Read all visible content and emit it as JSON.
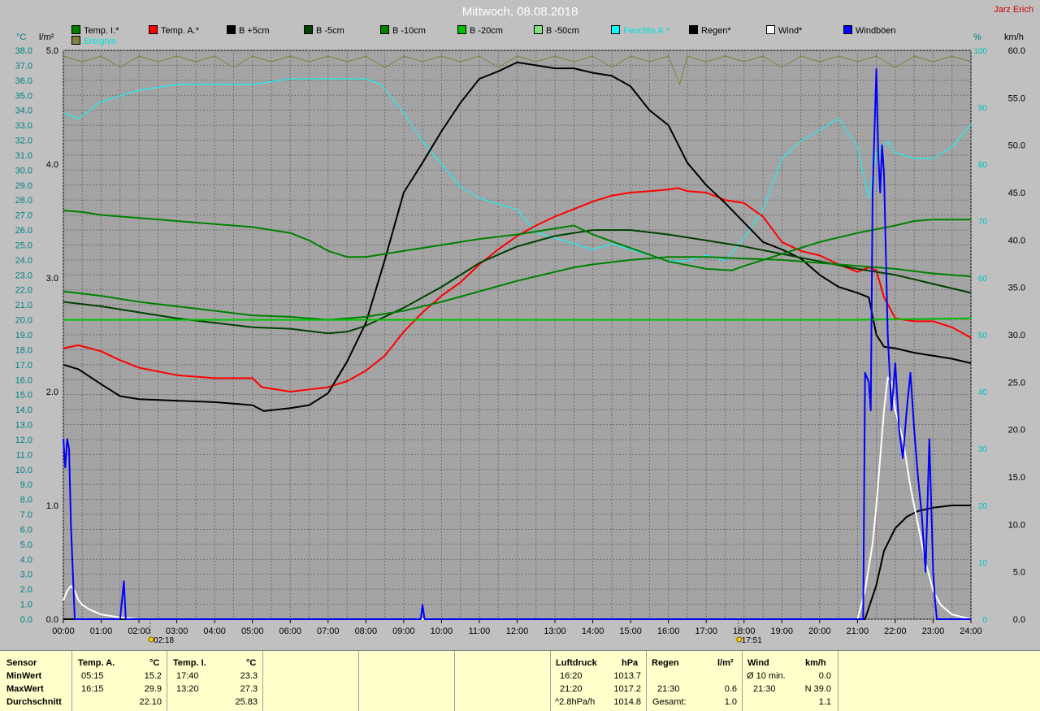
{
  "header": {
    "title": "Mittwoch, 08.08.2018",
    "author": "Jarz Erich"
  },
  "legend": [
    {
      "label": "Temp. I.*",
      "color": "#008000"
    },
    {
      "label": "Temp. A.*",
      "color": "#ff0000"
    },
    {
      "label": "B +5cm",
      "color": "#000000"
    },
    {
      "label": "B -5cm",
      "color": "#004000"
    },
    {
      "label": "B -10cm",
      "color": "#008000"
    },
    {
      "label": "B -20cm",
      "color": "#00c000"
    },
    {
      "label": "B -50cm",
      "color": "#80e080"
    },
    {
      "label": "Feuchte A.*",
      "color": "#00ffff"
    },
    {
      "label": "Regen*",
      "color": "#000000"
    },
    {
      "label": "Wind*",
      "color": "#ffffff"
    },
    {
      "label": "Windböen",
      "color": "#0000ff"
    },
    {
      "label": "Ereignis",
      "color": "#808040"
    }
  ],
  "units": {
    "left1": "°C",
    "left2": "l/m²",
    "right1": "%",
    "right2": "km/h"
  },
  "chart_data": {
    "type": "line",
    "x_range_hours": [
      0,
      24
    ],
    "x_tick_labels": [
      "00:00",
      "01:00",
      "02:00",
      "03:00",
      "04:00",
      "05:00",
      "06:00",
      "07:00",
      "08:00",
      "09:00",
      "10:00",
      "11:00",
      "12:00",
      "13:00",
      "14:00",
      "15:00",
      "16:00",
      "17:00",
      "18:00",
      "19:00",
      "20:00",
      "21:00",
      "22:00",
      "23:00",
      "24:00"
    ],
    "axes": {
      "temp_c": {
        "range": [
          0,
          38
        ],
        "step": 1
      },
      "rain_lm2": {
        "range": [
          0,
          5
        ],
        "ticks": [
          "0.0",
          "1.0",
          "2.0",
          "3.0",
          "4.0",
          "5.0"
        ]
      },
      "humidity_pct": {
        "range": [
          0,
          100
        ],
        "ticks": [
          "0",
          "10",
          "20",
          "30",
          "40",
          "50",
          "60",
          "70",
          "80",
          "90",
          "100"
        ]
      },
      "wind_kmh": {
        "range": [
          0,
          60
        ],
        "ticks": [
          "0.0",
          "5.0",
          "10.0",
          "15.0",
          "20.0",
          "25.0",
          "30.0",
          "35.0",
          "40.0",
          "45.0",
          "50.0",
          "55.0",
          "60.0"
        ]
      }
    },
    "grid": true,
    "annotations": [
      {
        "x": 2.3,
        "label": "02:18"
      },
      {
        "x": 17.85,
        "label": "17:51"
      }
    ],
    "series": [
      {
        "name": "Ereignis",
        "axis": "humidity_pct",
        "color": "#808040",
        "x": [
          0,
          0.5,
          1,
          1.5,
          2,
          2.5,
          3,
          3.5,
          4,
          4.5,
          5,
          5.5,
          6,
          6.5,
          7,
          7.5,
          8,
          8.5,
          9,
          9.5,
          10,
          10.5,
          11,
          11.5,
          12,
          12.5,
          13,
          13.5,
          14,
          14.5,
          15,
          15.5,
          16,
          16.3,
          16.5,
          17,
          17.5,
          18,
          18.5,
          19,
          19.5,
          20,
          20.5,
          21,
          21.5,
          22,
          22.5,
          23,
          23.5,
          24
        ],
        "y": [
          99,
          98,
          99,
          97,
          99,
          98,
          99,
          98,
          99,
          97,
          99,
          98,
          99,
          98,
          99,
          98,
          99,
          97,
          99,
          98,
          99,
          98,
          99,
          97,
          99,
          98,
          99,
          98,
          99,
          97,
          99,
          98,
          99,
          94,
          99,
          98,
          99,
          98,
          99,
          97,
          99,
          98,
          99,
          98,
          99,
          97,
          99,
          98,
          99,
          98
        ]
      },
      {
        "name": "Feuchte A.*",
        "axis": "humidity_pct",
        "color": "#00ffff",
        "x": [
          0,
          0.4,
          1,
          1.5,
          2,
          3,
          4,
          5,
          6,
          7,
          8,
          8.4,
          9,
          9.5,
          10,
          10.5,
          11,
          11.5,
          12,
          12.5,
          13,
          13.5,
          14,
          14.5,
          15,
          15.5,
          16,
          16.5,
          17,
          17.5,
          18,
          18.5,
          19,
          19.5,
          20,
          20.5,
          21,
          21.3,
          21.5,
          21.8,
          22,
          22.5,
          23,
          23.5,
          24
        ],
        "y": [
          89,
          88,
          91,
          92,
          93,
          94,
          94,
          94,
          95,
          95,
          95,
          94,
          89,
          84,
          80,
          76,
          74,
          73,
          72,
          68,
          67,
          66,
          65,
          66,
          65,
          64,
          63,
          63,
          64,
          63,
          67,
          72,
          81,
          84,
          86,
          88,
          83,
          74,
          82,
          84,
          82,
          81,
          81,
          83,
          87
        ]
      },
      {
        "name": "Temp. A.*",
        "axis": "temp_c",
        "color": "#ff0000",
        "x": [
          0,
          0.4,
          1,
          1.5,
          2,
          3,
          4,
          5,
          5.25,
          6,
          7,
          7.5,
          8,
          8.5,
          9,
          9.5,
          10,
          10.5,
          11,
          11.5,
          12,
          12.5,
          13,
          13.5,
          14,
          14.5,
          15,
          15.5,
          16,
          16.25,
          16.5,
          17,
          17.5,
          18,
          18.5,
          19,
          19.5,
          20,
          20.5,
          21,
          21.3,
          21.5,
          21.7,
          22,
          22.5,
          23,
          23.5,
          24
        ],
        "y": [
          18.1,
          18.3,
          17.9,
          17.3,
          16.8,
          16.3,
          16.1,
          16.1,
          15.5,
          15.2,
          15.5,
          15.9,
          16.6,
          17.6,
          19.2,
          20.5,
          21.6,
          22.5,
          23.7,
          24.7,
          25.6,
          26.3,
          26.9,
          27.4,
          27.9,
          28.3,
          28.5,
          28.6,
          28.7,
          28.8,
          28.6,
          28.5,
          28.0,
          27.8,
          26.9,
          25.2,
          24.6,
          24.3,
          23.7,
          23.2,
          23.5,
          23.3,
          21.5,
          20.1,
          19.9,
          19.9,
          19.5,
          18.8
        ]
      },
      {
        "name": "B +5cm",
        "axis": "temp_c",
        "color": "#000000",
        "x": [
          0,
          0.4,
          1,
          1.5,
          2,
          3,
          4,
          5,
          5.3,
          6,
          6.5,
          7,
          7.5,
          8,
          8.5,
          9,
          9.5,
          10,
          10.5,
          11,
          11.5,
          12,
          12.5,
          13,
          13.5,
          14,
          14.5,
          15,
          15.5,
          16,
          16.5,
          17,
          17.5,
          18,
          18.5,
          19,
          19.5,
          20,
          20.5,
          21,
          21.3,
          21.5,
          21.7,
          22,
          22.5,
          23,
          23.5,
          24
        ],
        "y": [
          17.0,
          16.7,
          15.7,
          14.9,
          14.7,
          14.6,
          14.5,
          14.3,
          13.9,
          14.1,
          14.3,
          15.1,
          17.2,
          19.8,
          24.0,
          28.5,
          30.5,
          32.6,
          34.5,
          36.1,
          36.6,
          37.2,
          37.0,
          36.8,
          36.8,
          36.5,
          36.3,
          35.6,
          34.0,
          33.0,
          30.5,
          29.0,
          27.8,
          26.5,
          25.2,
          24.7,
          24.1,
          23.0,
          22.2,
          21.8,
          21.5,
          19.0,
          18.2,
          18.1,
          17.8,
          17.6,
          17.4,
          17.1
        ]
      },
      {
        "name": "B -5cm",
        "axis": "temp_c",
        "color": "#004000",
        "x": [
          0,
          1,
          2,
          3,
          4,
          5,
          6,
          7,
          7.5,
          8,
          9,
          10,
          11,
          12,
          13,
          13.5,
          14,
          15,
          16,
          17,
          18,
          19,
          20,
          21,
          21.5,
          22,
          22.5,
          23,
          23.5,
          24
        ],
        "y": [
          21.2,
          20.9,
          20.5,
          20.1,
          19.8,
          19.5,
          19.4,
          19.1,
          19.2,
          19.6,
          20.8,
          22.2,
          23.8,
          24.9,
          25.6,
          25.8,
          26.0,
          26.0,
          25.7,
          25.3,
          24.9,
          24.4,
          23.9,
          23.4,
          23.2,
          23.0,
          22.7,
          22.4,
          22.1,
          21.8
        ]
      },
      {
        "name": "B -10cm",
        "axis": "temp_c",
        "color": "#008000",
        "x": [
          0,
          1,
          2,
          3,
          4,
          5,
          6,
          7,
          7.5,
          8,
          9,
          10,
          11,
          12,
          13,
          13.5,
          14,
          15,
          16,
          17,
          18,
          19,
          20,
          21,
          22,
          23,
          24
        ],
        "y": [
          21.9,
          21.6,
          21.2,
          20.9,
          20.6,
          20.3,
          20.2,
          20.0,
          20.1,
          20.2,
          20.6,
          21.2,
          21.9,
          22.6,
          23.2,
          23.5,
          23.7,
          24.0,
          24.2,
          24.2,
          24.1,
          24.0,
          23.8,
          23.6,
          23.4,
          23.1,
          22.9
        ]
      },
      {
        "name": "Temp. I.*",
        "axis": "temp_c",
        "color": "#008000",
        "x": [
          0,
          0.5,
          1,
          2,
          3,
          4,
          5,
          6,
          6.5,
          7,
          7.5,
          8,
          9,
          10,
          11,
          12,
          13,
          13.5,
          14,
          15,
          16,
          17,
          17.67,
          18,
          19,
          20,
          21,
          22,
          22.5,
          23,
          24
        ],
        "y": [
          27.3,
          27.2,
          27.0,
          26.8,
          26.6,
          26.4,
          26.2,
          25.8,
          25.3,
          24.6,
          24.2,
          24.2,
          24.6,
          25.0,
          25.4,
          25.7,
          26.1,
          26.3,
          25.7,
          24.8,
          23.9,
          23.4,
          23.3,
          23.6,
          24.4,
          25.2,
          25.8,
          26.3,
          26.6,
          26.7,
          26.7
        ]
      },
      {
        "name": "B -20cm",
        "axis": "temp_c",
        "color": "#00c000",
        "x": [
          0,
          6,
          9,
          12,
          15,
          18,
          21,
          24
        ],
        "y": [
          20.0,
          20.0,
          20.0,
          20.0,
          20.0,
          20.0,
          20.0,
          20.1
        ]
      },
      {
        "name": "Regen*",
        "axis": "rain_lm2",
        "color": "#000000",
        "x": [
          0,
          21.2,
          21.3,
          21.4,
          21.5,
          21.6,
          21.7,
          22.0,
          22.3,
          22.6,
          23.0,
          23.5,
          24
        ],
        "y": [
          0,
          0,
          0.1,
          0.2,
          0.3,
          0.45,
          0.6,
          0.8,
          0.9,
          0.95,
          0.98,
          1.0,
          1.0
        ]
      },
      {
        "name": "Wind*",
        "axis": "wind_kmh",
        "color": "#ffffff",
        "x": [
          0,
          0.1,
          0.2,
          0.3,
          0.4,
          0.5,
          0.7,
          1,
          1.5,
          2,
          21,
          21.2,
          21.4,
          21.5,
          21.6,
          21.7,
          21.8,
          21.9,
          22,
          22.2,
          22.4,
          22.6,
          22.8,
          23,
          23.2,
          23.5,
          24
        ],
        "y": [
          2,
          3,
          3.5,
          3,
          2,
          1.5,
          1,
          0.5,
          0.2,
          0,
          0,
          3,
          8,
          12,
          17,
          22,
          25.5,
          25,
          22,
          19,
          14,
          10,
          6,
          3,
          1.5,
          0.5,
          0
        ]
      },
      {
        "name": "Windböen",
        "axis": "wind_kmh",
        "color": "#0000ff",
        "x": [
          0,
          0.05,
          0.1,
          0.15,
          0.2,
          0.25,
          0.3,
          0.35,
          0.4,
          0.45,
          1.5,
          1.6,
          1.65,
          1.7,
          9.45,
          9.5,
          9.55,
          21.15,
          21.2,
          21.3,
          21.35,
          21.4,
          21.5,
          21.55,
          21.6,
          21.65,
          21.7,
          21.8,
          21.9,
          22.0,
          22.1,
          22.2,
          22.3,
          22.4,
          22.5,
          22.6,
          22.7,
          22.8,
          22.9,
          23.0,
          23.05,
          23.1,
          23.2,
          24
        ],
        "y": [
          19,
          16,
          19,
          18,
          10,
          5,
          0,
          0,
          0,
          0,
          0,
          4,
          0,
          0,
          0,
          1.5,
          0,
          0,
          26,
          25,
          22,
          45,
          58,
          49,
          45,
          50,
          47,
          30,
          22,
          27,
          20,
          17,
          22,
          26,
          20,
          15,
          11,
          5,
          19,
          5,
          2,
          0,
          0,
          0
        ]
      }
    ]
  },
  "footer": {
    "sensor": {
      "header": "Sensor",
      "rows": [
        "MinWert",
        "MaxWert",
        "Durchschnitt"
      ]
    },
    "temp_a": {
      "header": "Temp. A.",
      "unit": "°C",
      "rows": [
        {
          "time": "05:15",
          "val": "15.2"
        },
        {
          "time": "16:15",
          "val": "29.9"
        },
        {
          "time": "",
          "val": "22.10"
        }
      ]
    },
    "temp_i": {
      "header": "Temp. I.",
      "unit": "°C",
      "rows": [
        {
          "time": "17:40",
          "val": "23.3"
        },
        {
          "time": "13:20",
          "val": "27.3"
        },
        {
          "time": "",
          "val": "25.83"
        }
      ]
    },
    "pressure": {
      "header": "Luftdruck",
      "unit": "hPa",
      "rows": [
        {
          "time": "16:20",
          "val": "1013.7"
        },
        {
          "time": "21:20",
          "val": "1017.2"
        },
        {
          "time": "^2.8hPa/h",
          "val": "1014.8"
        }
      ]
    },
    "rain": {
      "header": "Regen",
      "unit": "l/m²",
      "rows": [
        {
          "time": "",
          "val": ""
        },
        {
          "time": "21:30",
          "val": "0.6"
        },
        {
          "time": "Gesamt:",
          "val": "1.0"
        }
      ]
    },
    "wind": {
      "header": "Wind",
      "unit": "km/h",
      "rows": [
        {
          "time": "Ø 10 min.",
          "val": "0.0"
        },
        {
          "time": "21:30",
          "val": "N 39.0"
        },
        {
          "time": "",
          "val": "1.1"
        }
      ]
    }
  }
}
